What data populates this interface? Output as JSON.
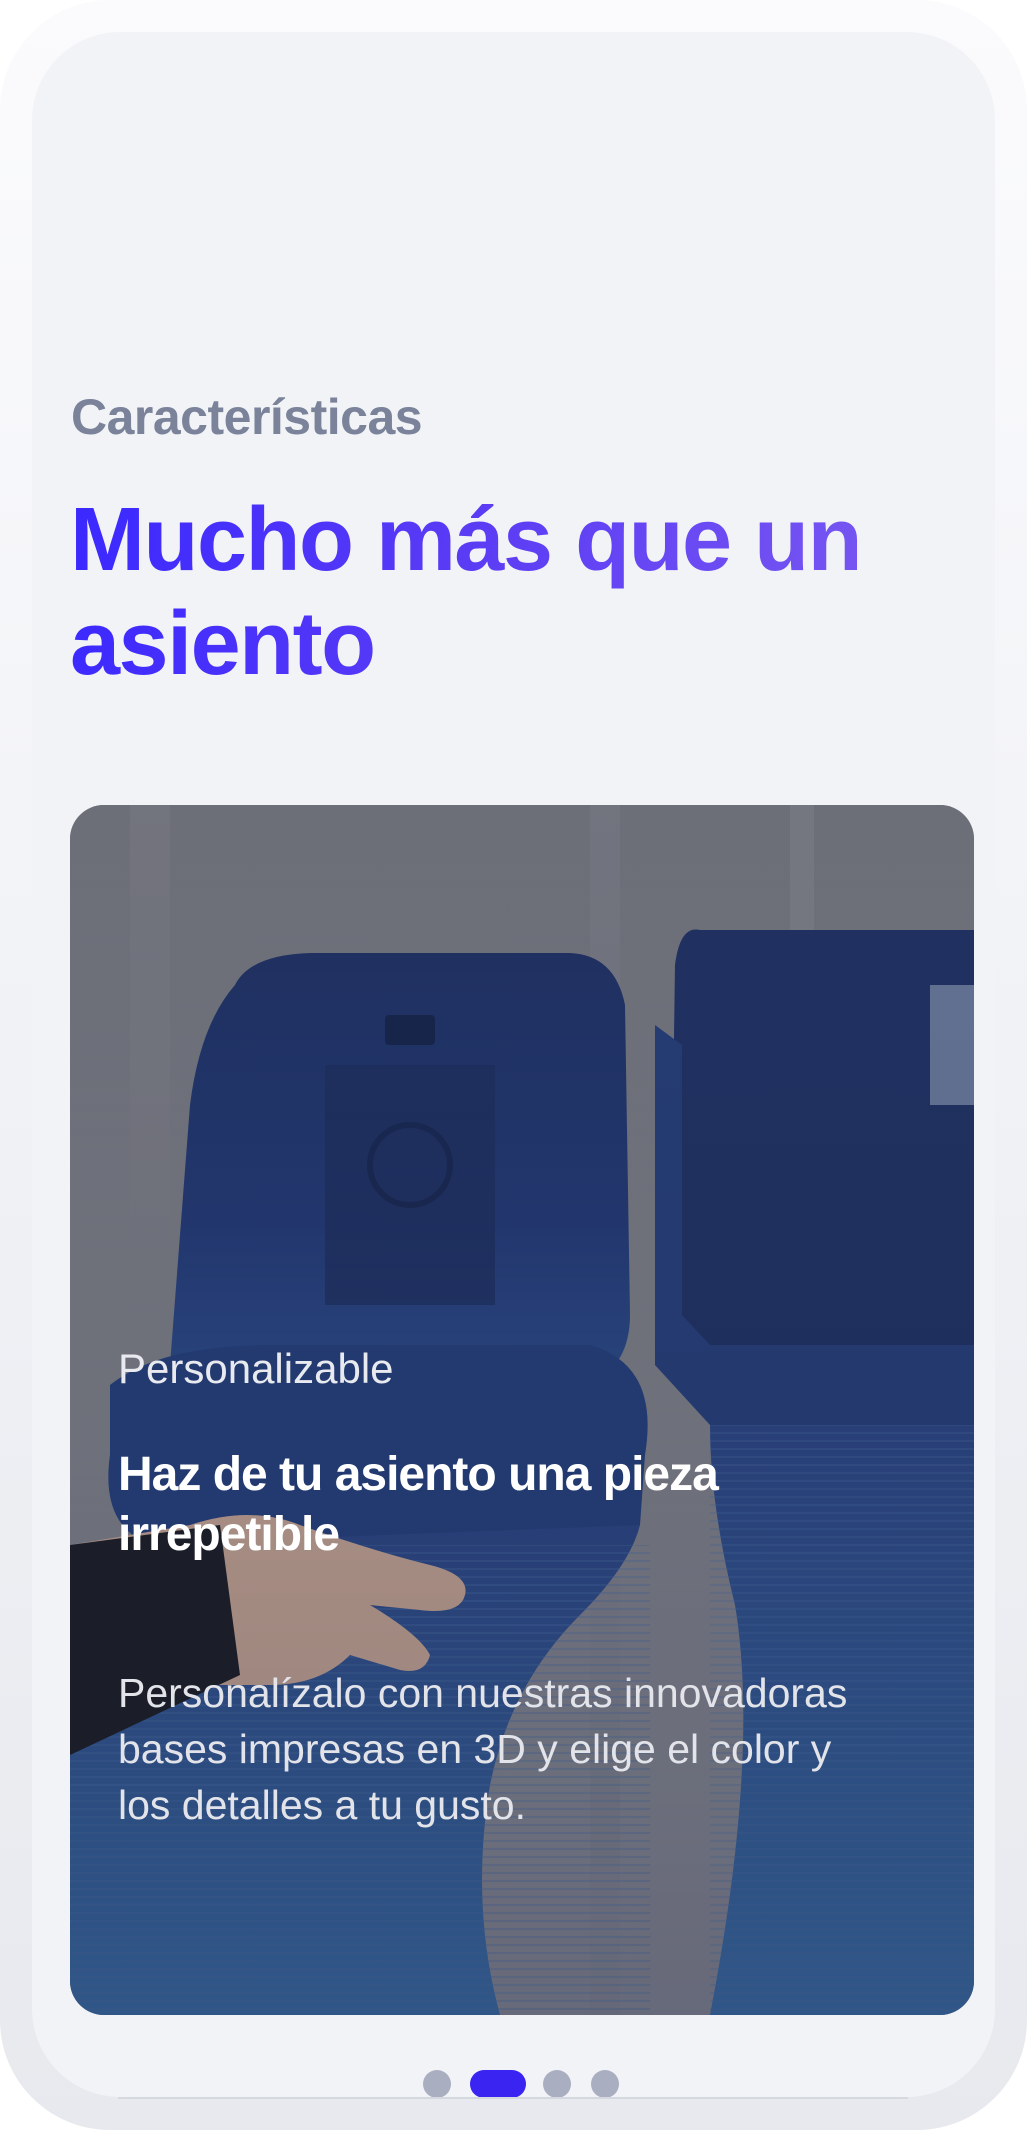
{
  "section": {
    "eyebrow": "Características",
    "headline": "Mucho más que un asiento"
  },
  "card": {
    "image": "stadium-seat-3d-printed-base-photo",
    "label": "Personalizable",
    "title": "Haz de tu asiento una pieza irrepetible",
    "body": "Personalízalo con nuestras innovadoras bases impresas en 3D y elige el color y los detalles a tu gusto."
  },
  "pager": {
    "total": 4,
    "active_index": 1
  },
  "colors": {
    "accent": "#3a24f2",
    "headline_gradient_start": "#3a28ff",
    "headline_gradient_end": "#7d5cf0",
    "eyebrow": "#7a8399",
    "background": "#f2f3f7",
    "dot_inactive": "#a9aec0"
  }
}
